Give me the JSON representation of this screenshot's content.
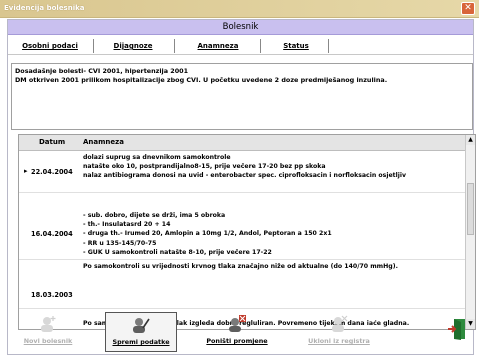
{
  "app": {
    "title": "Evidencija bolesnika"
  },
  "panel": {
    "heading": "Bolesnik"
  },
  "tabs": [
    {
      "label": "Osobni podaci"
    },
    {
      "label": "Dijagnoze"
    },
    {
      "label": "Anamneza"
    },
    {
      "label": "Status"
    }
  ],
  "summary": {
    "line1": "Dosadašnje bolesti- CVI 2001, hipertenzija 2001",
    "line2": "DM otkriven 2001 prilikom hospitalizacije zbog CVI. U početku uvedene 2 doze predmiješanog inzulina."
  },
  "table": {
    "columns": [
      "Datum",
      "Anamneza"
    ],
    "selected_marker": "▸",
    "rows": [
      {
        "date": "22.04.2004",
        "lines": [
          "dolazi suprug sa dnevnikom samokontrole",
          "natašte oko 10, postprandijalno8-15, prije večere 17-20 bez pp skoka",
          "nalaz antibiograma donosi na uvid - enterobacter spec. ciprofloksacin i norfloksacin osjetljiv"
        ]
      },
      {
        "date": "16.04.2004",
        "lines": [
          "- sub. dobro, dijete se drži, ima 5 obroka",
          "- th.- Insulatasrd 20 + 14",
          "- druga th.-  Irumed 20, Amlopin a 10mg 1/2, Andol, Peptoran a 150 2x1",
          "- RR u 135-145/70-75",
          "- GUK U samokontroli natašte 8-10, prije večere 17-22"
        ]
      },
      {
        "date": "18.03.2003",
        "lines": [
          "Po samokontroli su vrijednosti krvnog tlaka značajno niže od aktualne (do 140/70 mmHg)."
        ]
      },
      {
        "date": "",
        "lines": [
          "Po samomjerenjima krvni tlak izgleda dobro regluliran. Povremeno tijekom dana iaće gladna."
        ]
      }
    ]
  },
  "toolbar": {
    "new_patient": "Novi bolesnik",
    "save": "Spremi podatke",
    "cancel": "Poništi promjene",
    "delete": "Ukloni iz registra"
  },
  "colors": {
    "titlebar": "#d9c68f",
    "panel_header": "#c9c0ef",
    "close_button": "#d8653a"
  }
}
